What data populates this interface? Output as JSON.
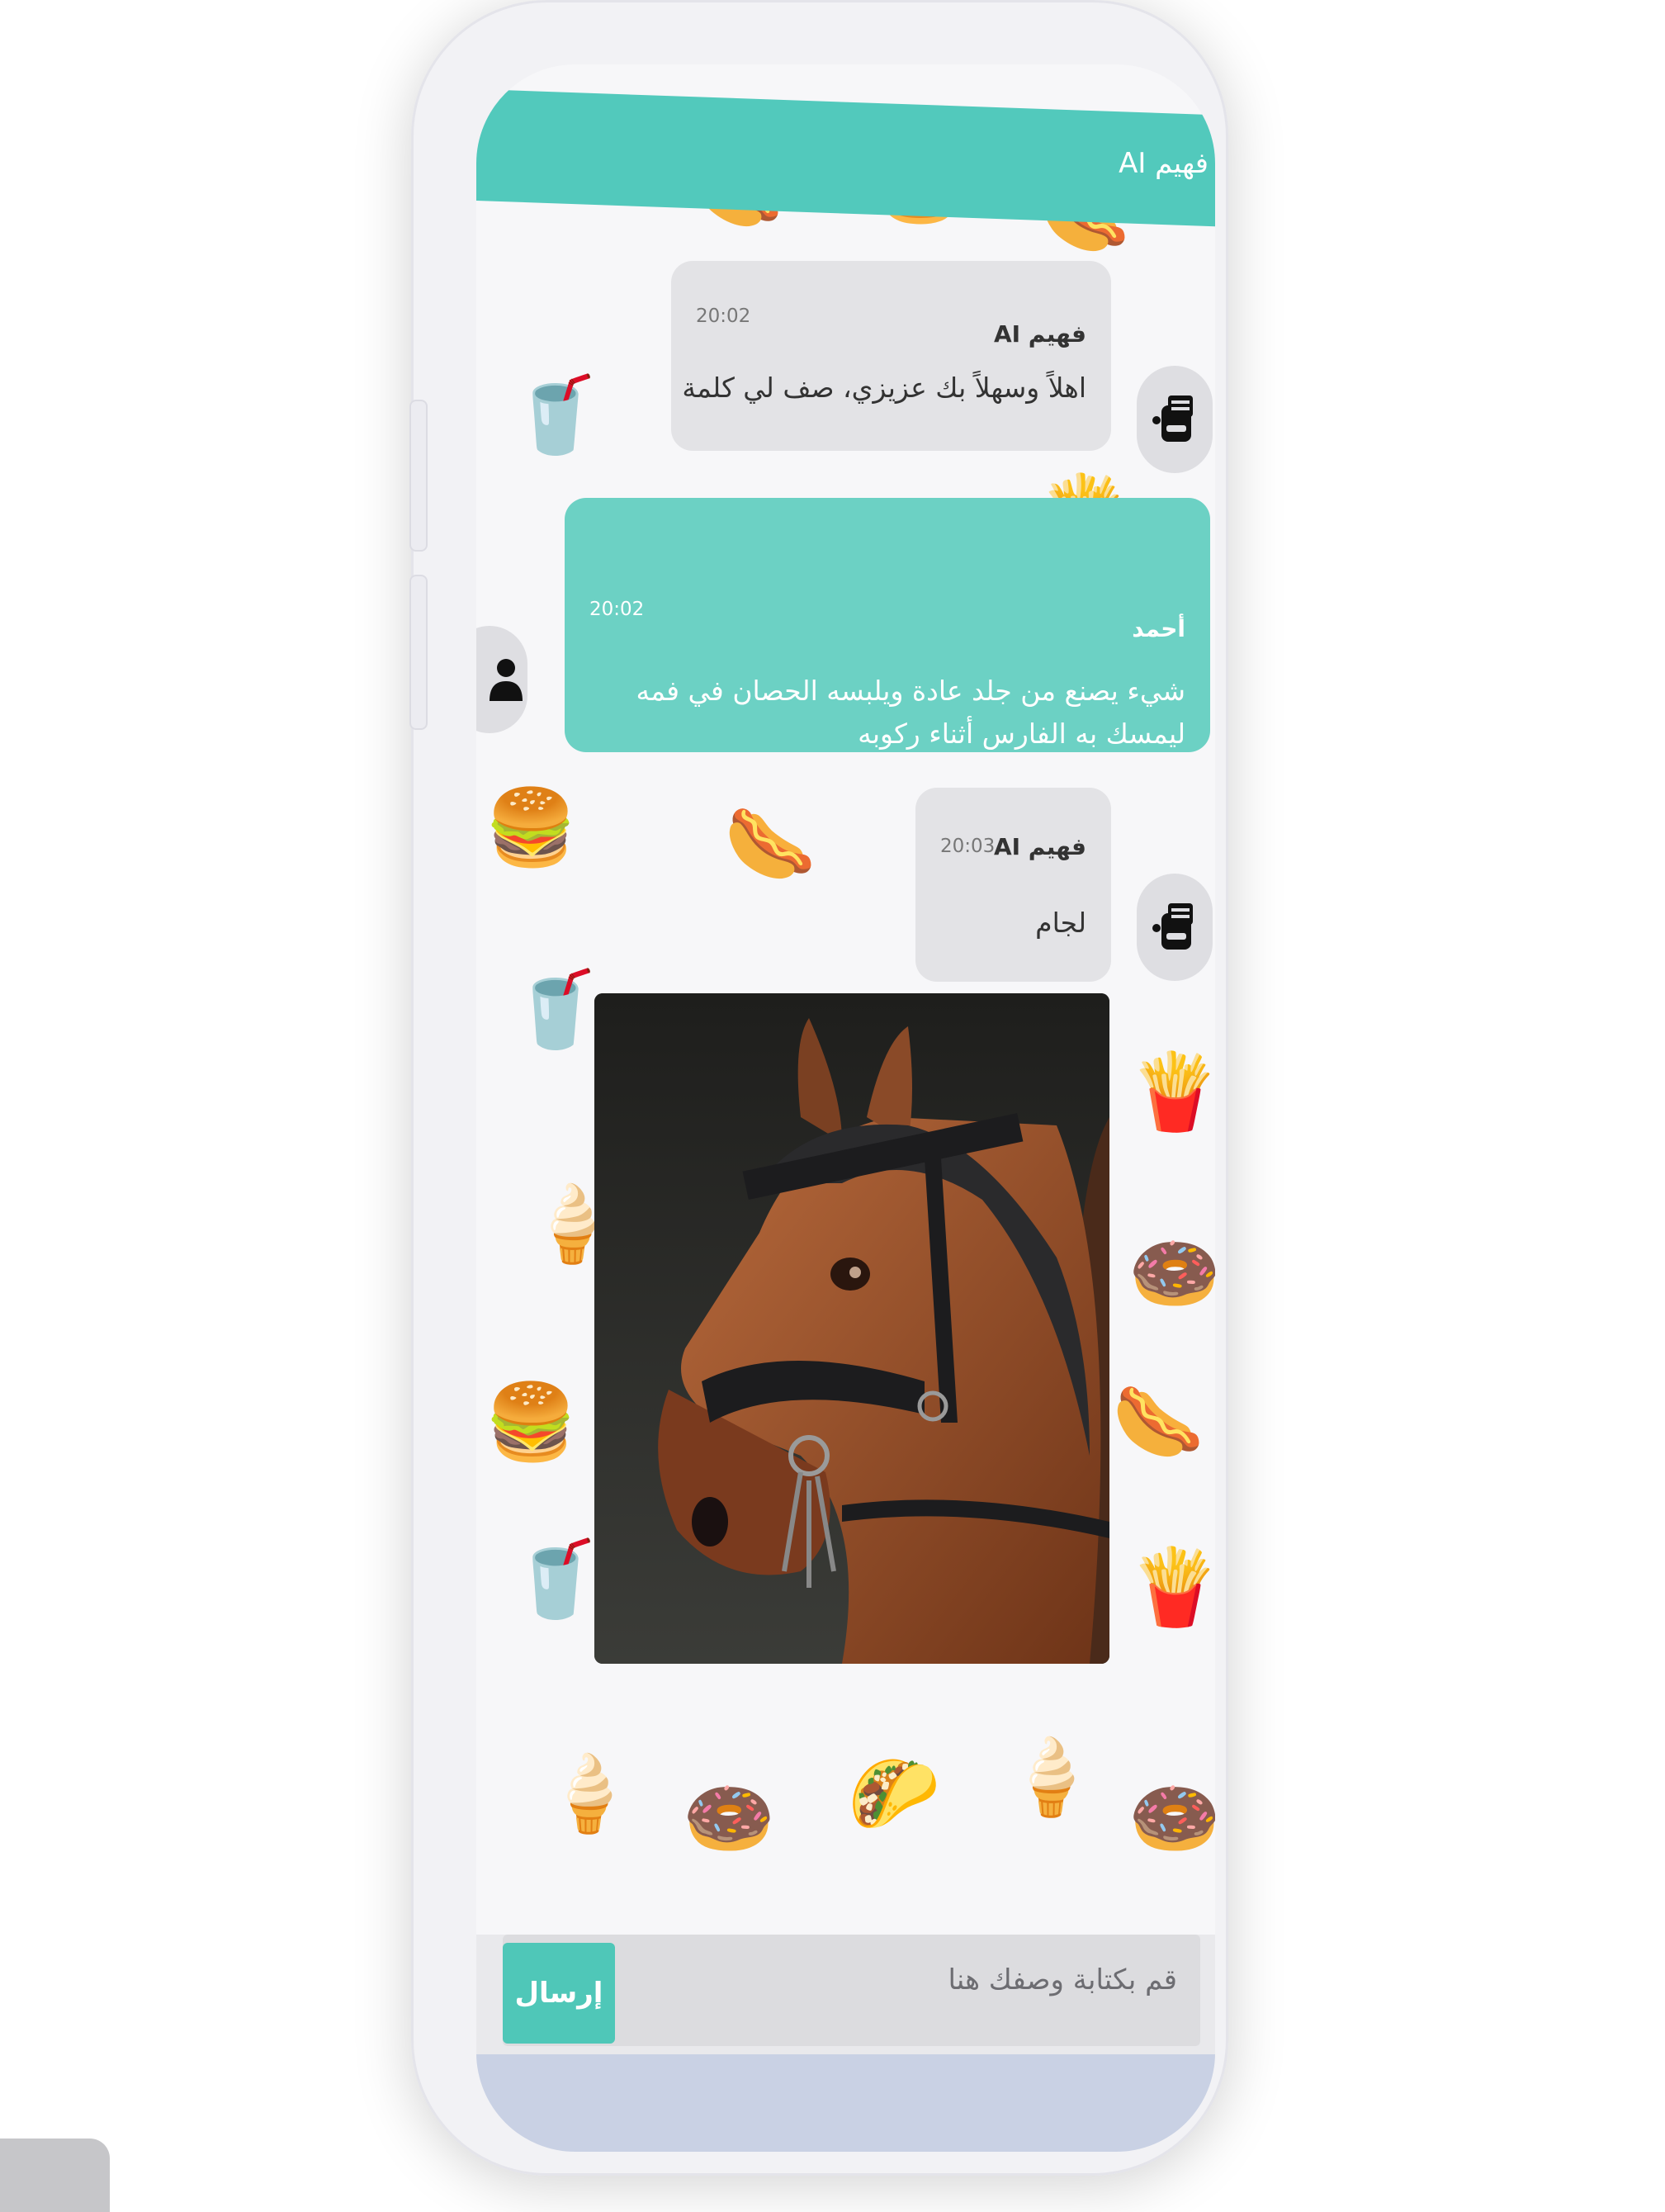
{
  "header": {
    "title": "فهيم AI"
  },
  "messages": [
    {
      "sender": "فهيم AI",
      "time": "20:02",
      "text": "اهلاً وسهلاً بك عزيزي، صف لي كلمة"
    },
    {
      "sender": "أحمد",
      "time": "20:02",
      "text_line1": "شيء يصنع من جلد عادة ويلبسه الحصان في فمه",
      "text_line2": "ليمسك به الفارس أثناء ركوبه"
    },
    {
      "sender": "فهيم AI",
      "time": "20:03",
      "text": "لجام"
    }
  ],
  "composer": {
    "placeholder": "قم بكتابة وصفك هنا",
    "send_label": "إرسال"
  },
  "colors": {
    "accent": "#52c9bc",
    "user_bubble": "#6cd1c4",
    "ai_bubble": "#e3e3e6"
  },
  "icons": {
    "bot_avatar": "robot-icon",
    "user_avatar": "user-icon"
  }
}
